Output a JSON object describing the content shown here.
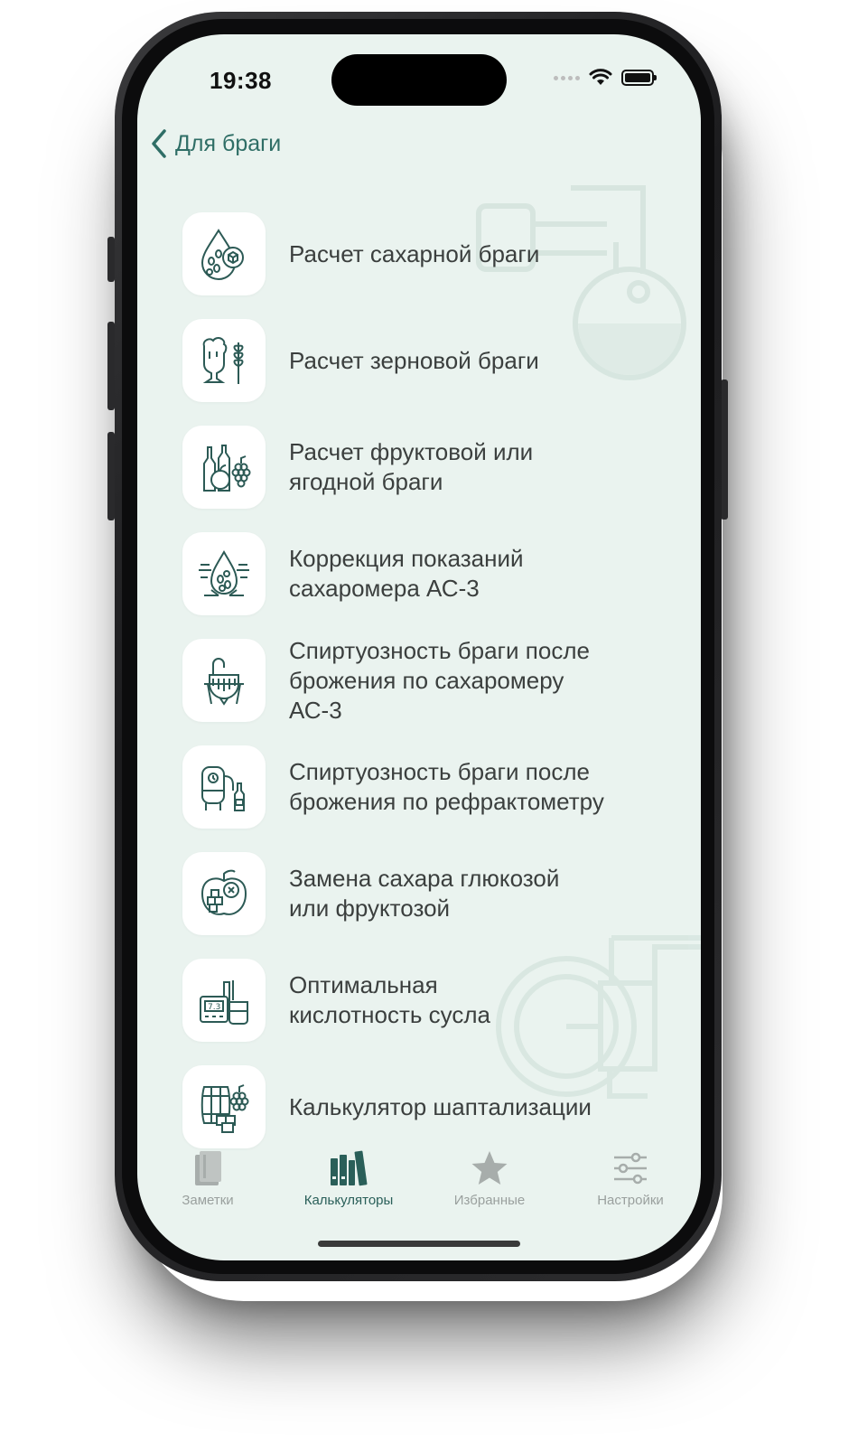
{
  "status_bar": {
    "time": "19:38"
  },
  "nav": {
    "back_label": "Для браги"
  },
  "colors": {
    "accent": "#2f6e66",
    "screen_background": "#eaf3ef",
    "tab_active": "#2a5f59",
    "tab_inactive": "#9aa09e"
  },
  "calculators": [
    {
      "label": "Расчет сахарной браги",
      "icon": "sugar-drop-icon"
    },
    {
      "label": "Расчет зерновой браги",
      "icon": "beer-wheat-icon"
    },
    {
      "label": "Расчет фруктовой или\nягодной браги",
      "icon": "fruit-bottles-icon"
    },
    {
      "label": "Коррекция показаний\nсахаромера АС-3",
      "icon": "hydrometer-drop-icon"
    },
    {
      "label": "Спиртуозность браги после\nброжения по сахаромеру\nАС-3",
      "icon": "fermenter-icon"
    },
    {
      "label": "Спиртуозность браги после\nброжения по рефрактометру",
      "icon": "tank-bottle-icon"
    },
    {
      "label": "Замена сахара глюкозой\nили фруктозой",
      "icon": "apple-sugar-icon"
    },
    {
      "label": "Оптимальная\nкислотность сусла",
      "icon": "ph-meter-icon"
    },
    {
      "label": "Калькулятор шаптализации",
      "icon": "barrel-grapes-icon"
    }
  ],
  "tabs": [
    {
      "label": "Заметки",
      "icon": "notebook-icon",
      "active": false
    },
    {
      "label": "Калькуляторы",
      "icon": "books-icon",
      "active": true
    },
    {
      "label": "Избранные",
      "icon": "star-icon",
      "active": false
    },
    {
      "label": "Настройки",
      "icon": "sliders-icon",
      "active": false
    }
  ]
}
